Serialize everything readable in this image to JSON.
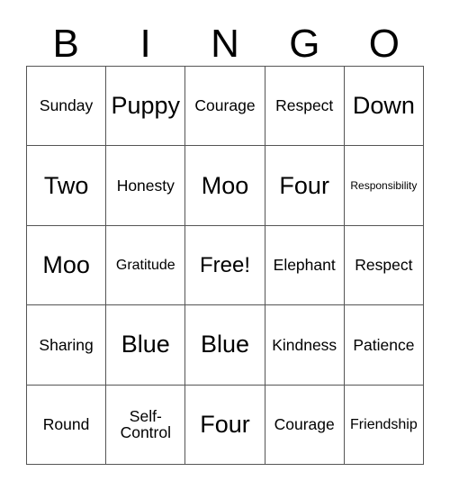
{
  "card": {
    "type": "bingo-card",
    "header_letters": [
      "B",
      "I",
      "N",
      "G",
      "O"
    ],
    "columns": 5,
    "rows": 5,
    "free_space": "Free!",
    "colors": {
      "text": "#000000",
      "grid_line": "#555555",
      "background": "#ffffff"
    },
    "cells": [
      [
        {
          "text": "Sunday",
          "size": "md"
        },
        {
          "text": "Puppy",
          "size": "xl"
        },
        {
          "text": "Courage",
          "size": "md"
        },
        {
          "text": "Respect",
          "size": "md"
        },
        {
          "text": "Down",
          "size": "xl"
        }
      ],
      [
        {
          "text": "Two",
          "size": "xl"
        },
        {
          "text": "Honesty",
          "size": "md"
        },
        {
          "text": "Moo",
          "size": "xl"
        },
        {
          "text": "Four",
          "size": "xl"
        },
        {
          "text": "Responsibility",
          "size": "xs"
        }
      ],
      [
        {
          "text": "Moo",
          "size": "xl"
        },
        {
          "text": "Gratitude",
          "size": "sm"
        },
        {
          "text": "Free!",
          "size": "lg"
        },
        {
          "text": "Elephant",
          "size": "md"
        },
        {
          "text": "Respect",
          "size": "md"
        }
      ],
      [
        {
          "text": "Sharing",
          "size": "md"
        },
        {
          "text": "Blue",
          "size": "xl"
        },
        {
          "text": "Blue",
          "size": "xl"
        },
        {
          "text": "Kindness",
          "size": "md"
        },
        {
          "text": "Patience",
          "size": "md"
        }
      ],
      [
        {
          "text": "Round",
          "size": "md"
        },
        {
          "text": "Self-\nControl",
          "size": "md"
        },
        {
          "text": "Four",
          "size": "xl"
        },
        {
          "text": "Courage",
          "size": "md"
        },
        {
          "text": "Friendship",
          "size": "sm"
        }
      ]
    ]
  }
}
